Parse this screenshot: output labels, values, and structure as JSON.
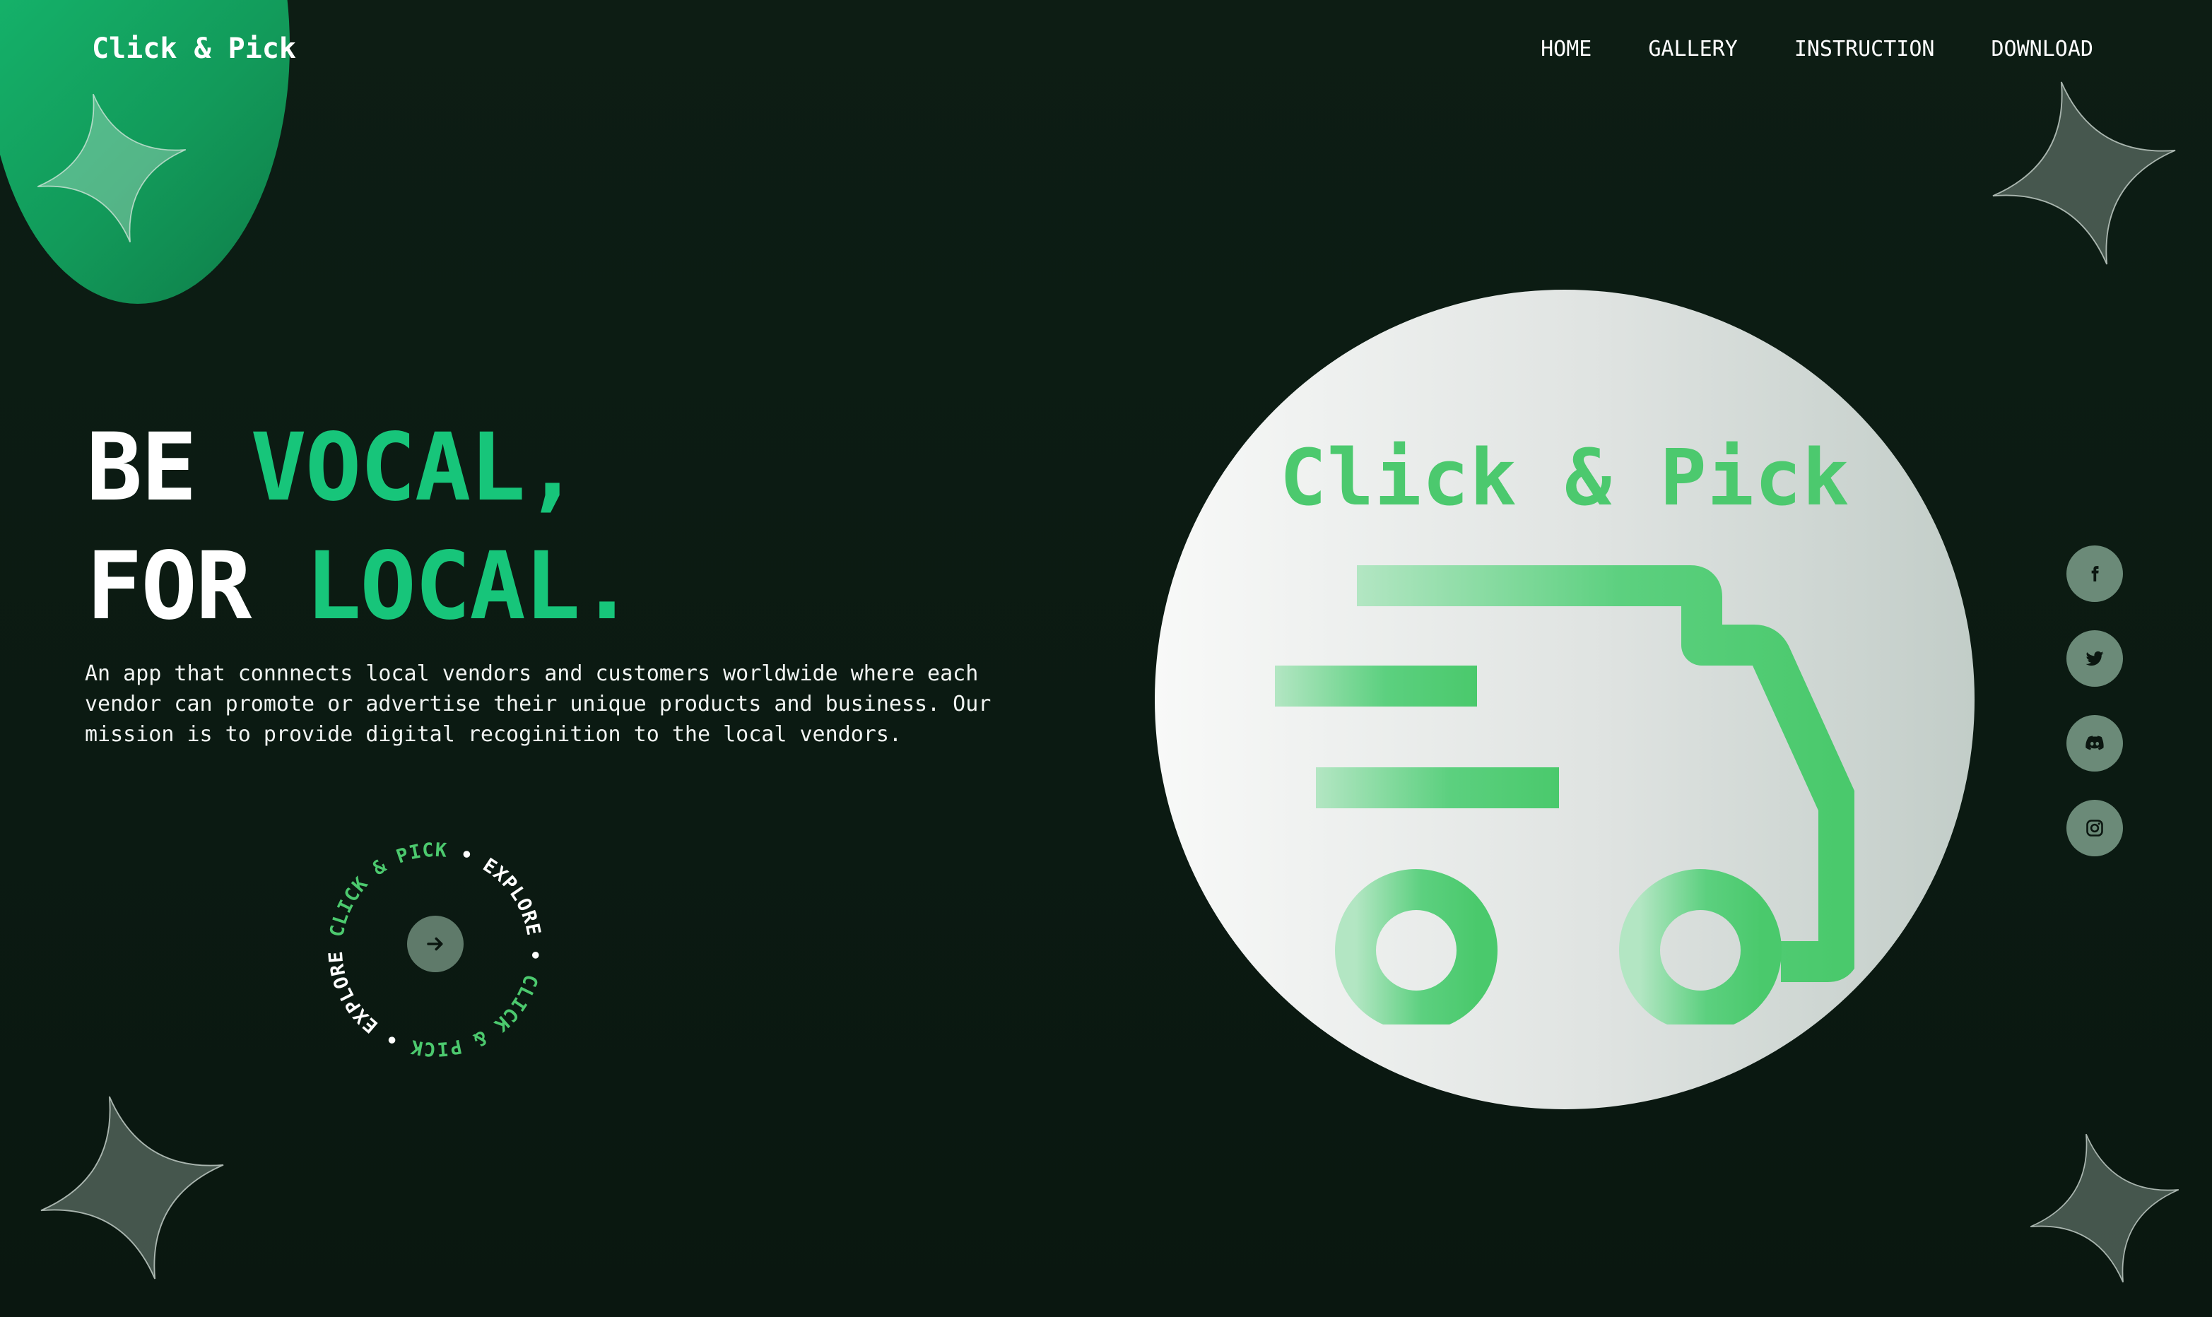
{
  "brand": {
    "name": "Click & Pick"
  },
  "nav": {
    "items": [
      {
        "label": "HOME"
      },
      {
        "label": "GALLERY"
      },
      {
        "label": "INSTRUCTION"
      },
      {
        "label": "DOWNLOAD"
      }
    ]
  },
  "hero": {
    "line1_a": "BE ",
    "line1_b": "VOCAL,",
    "line2_a": "FOR ",
    "line2_b": "LOCAL.",
    "description": "An app that connnects local vendors and customers worldwide where each vendor can promote or advertise their unique products and business. Our mission is to provide digital recoginition to the local vendors."
  },
  "explore": {
    "ring_segments": [
      {
        "text": "CLICK & PICK",
        "color": "#4cc96e"
      },
      {
        "text": "EXPLORE",
        "color": "#ffffff"
      },
      {
        "text": "CLICK & PICK",
        "color": "#4cc96e"
      },
      {
        "text": "EXPLORE",
        "color": "#ffffff"
      }
    ],
    "separator": "•",
    "button_icon": "arrow-right-icon"
  },
  "logo": {
    "text": "Click & Pick",
    "icon": "delivery-truck-icon"
  },
  "social": [
    {
      "icon": "facebook-icon"
    },
    {
      "icon": "twitter-icon"
    },
    {
      "icon": "discord-icon"
    },
    {
      "icon": "instagram-icon"
    }
  ],
  "colors": {
    "background": "#0c1a13",
    "accent": "#17c57a",
    "logo_green": "#4cc96e",
    "corner_blob": "#129a5a",
    "social_button": "#6b8a78",
    "explore_button": "#5f7a6a"
  }
}
